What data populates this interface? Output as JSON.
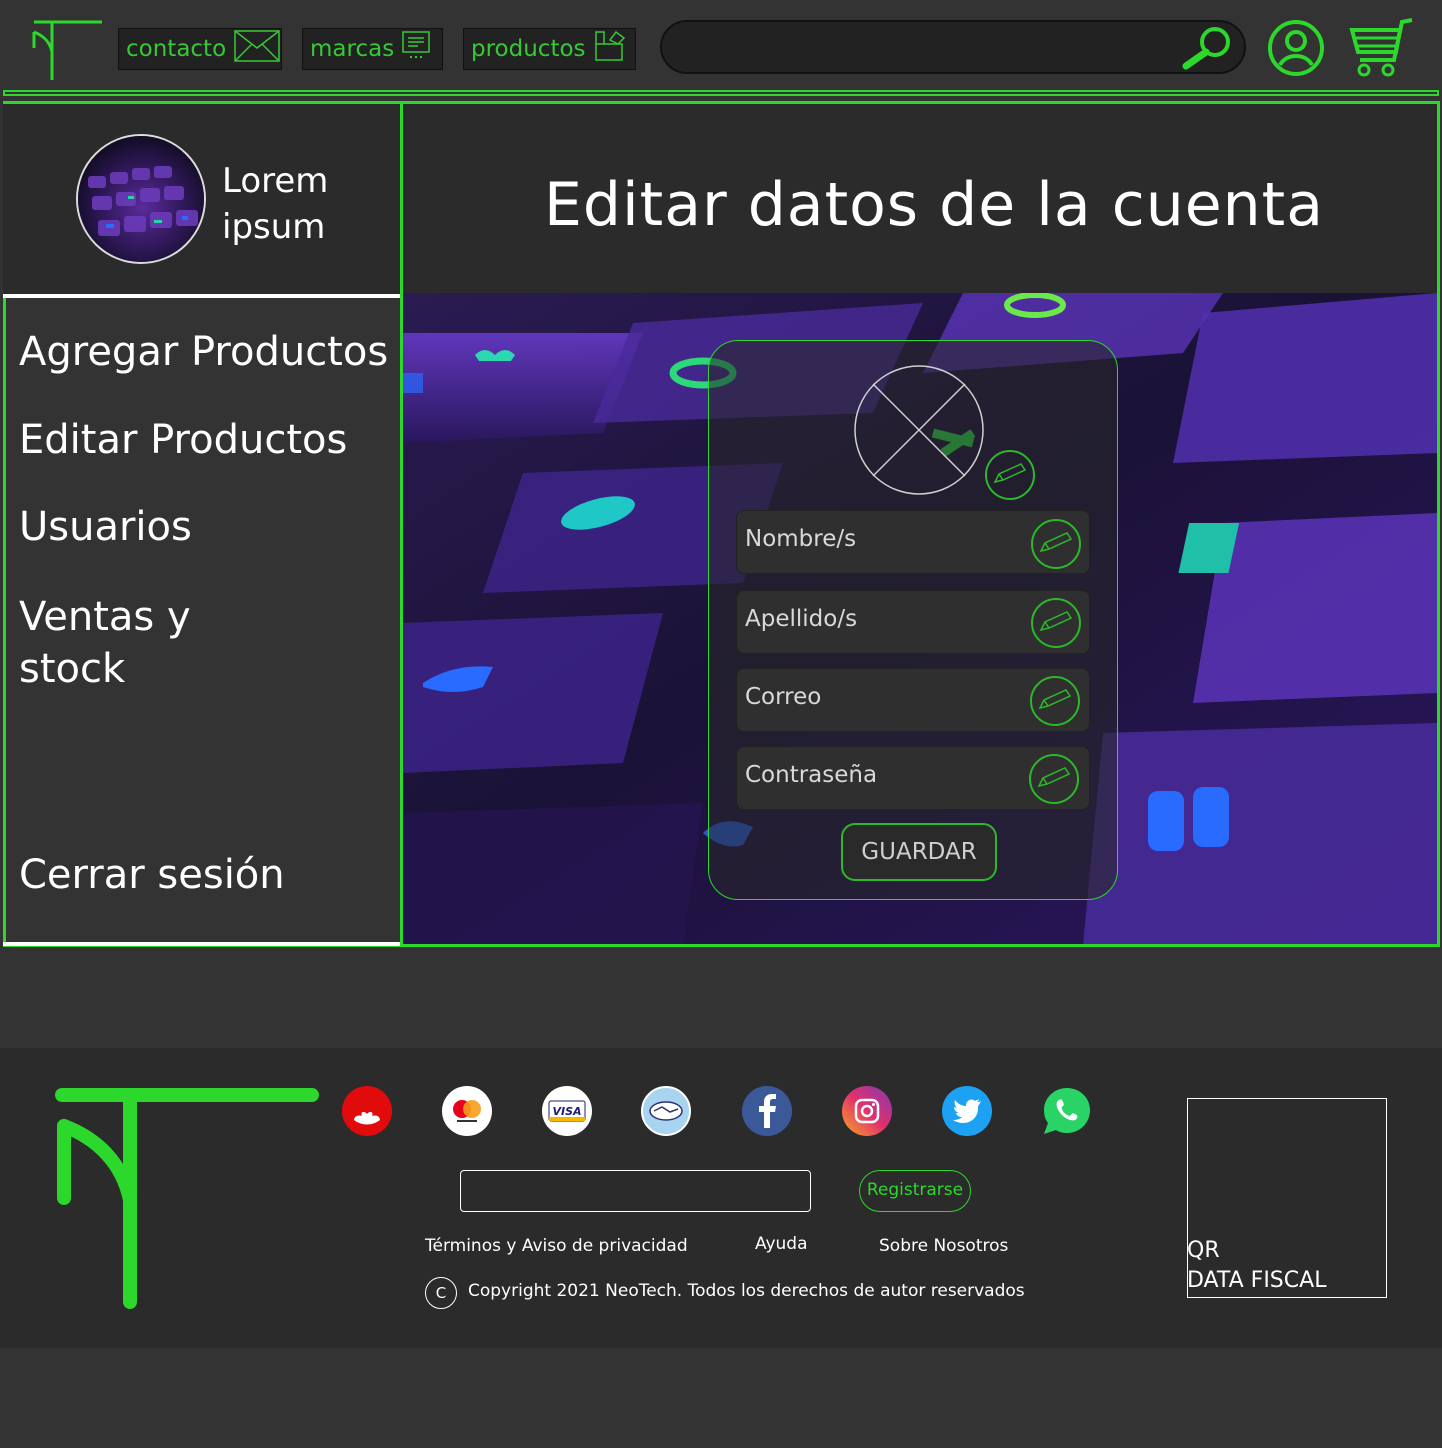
{
  "header": {
    "nav": {
      "contacto": "contacto",
      "marcas": "marcas",
      "productos": "productos"
    },
    "search_value": ""
  },
  "sidebar": {
    "user_name_line1": "Lorem",
    "user_name_line2": "ipsum",
    "items": [
      {
        "label": "Agregar Productos"
      },
      {
        "label": "Editar Productos"
      },
      {
        "label": "Usuarios"
      },
      {
        "label_line1": "Ventas y",
        "label_line2": "stock"
      },
      {
        "label": "Cerrar sesión"
      }
    ]
  },
  "main": {
    "title": "Editar datos de la cuenta",
    "form": {
      "fields": [
        {
          "placeholder": "Nombre/s"
        },
        {
          "placeholder": "Apellido/s"
        },
        {
          "placeholder": "Correo"
        },
        {
          "placeholder": "Contraseña"
        }
      ],
      "save_label": "GUARDAR"
    }
  },
  "footer": {
    "payment_icons": [
      "santander-icon",
      "mastercard-icon",
      "visa-icon",
      "mercadopago-icon"
    ],
    "social_icons": [
      "facebook-icon",
      "instagram-icon",
      "twitter-icon",
      "whatsapp-icon"
    ],
    "newsletter_value": "",
    "register_label": "Registrarse",
    "links": {
      "terms": "Términos y Aviso de privacidad",
      "help": "Ayuda",
      "about": "Sobre Nosotros"
    },
    "copyright_symbol": "C",
    "copyright": "Copyright 2021 NeoTech. Todos los derechos de autor reservados",
    "qr_line1": "QR",
    "qr_line2": "DATA FISCAL"
  },
  "colors": {
    "accent": "#2bd82b",
    "background": "#333333",
    "panel": "#2b2b2b"
  }
}
